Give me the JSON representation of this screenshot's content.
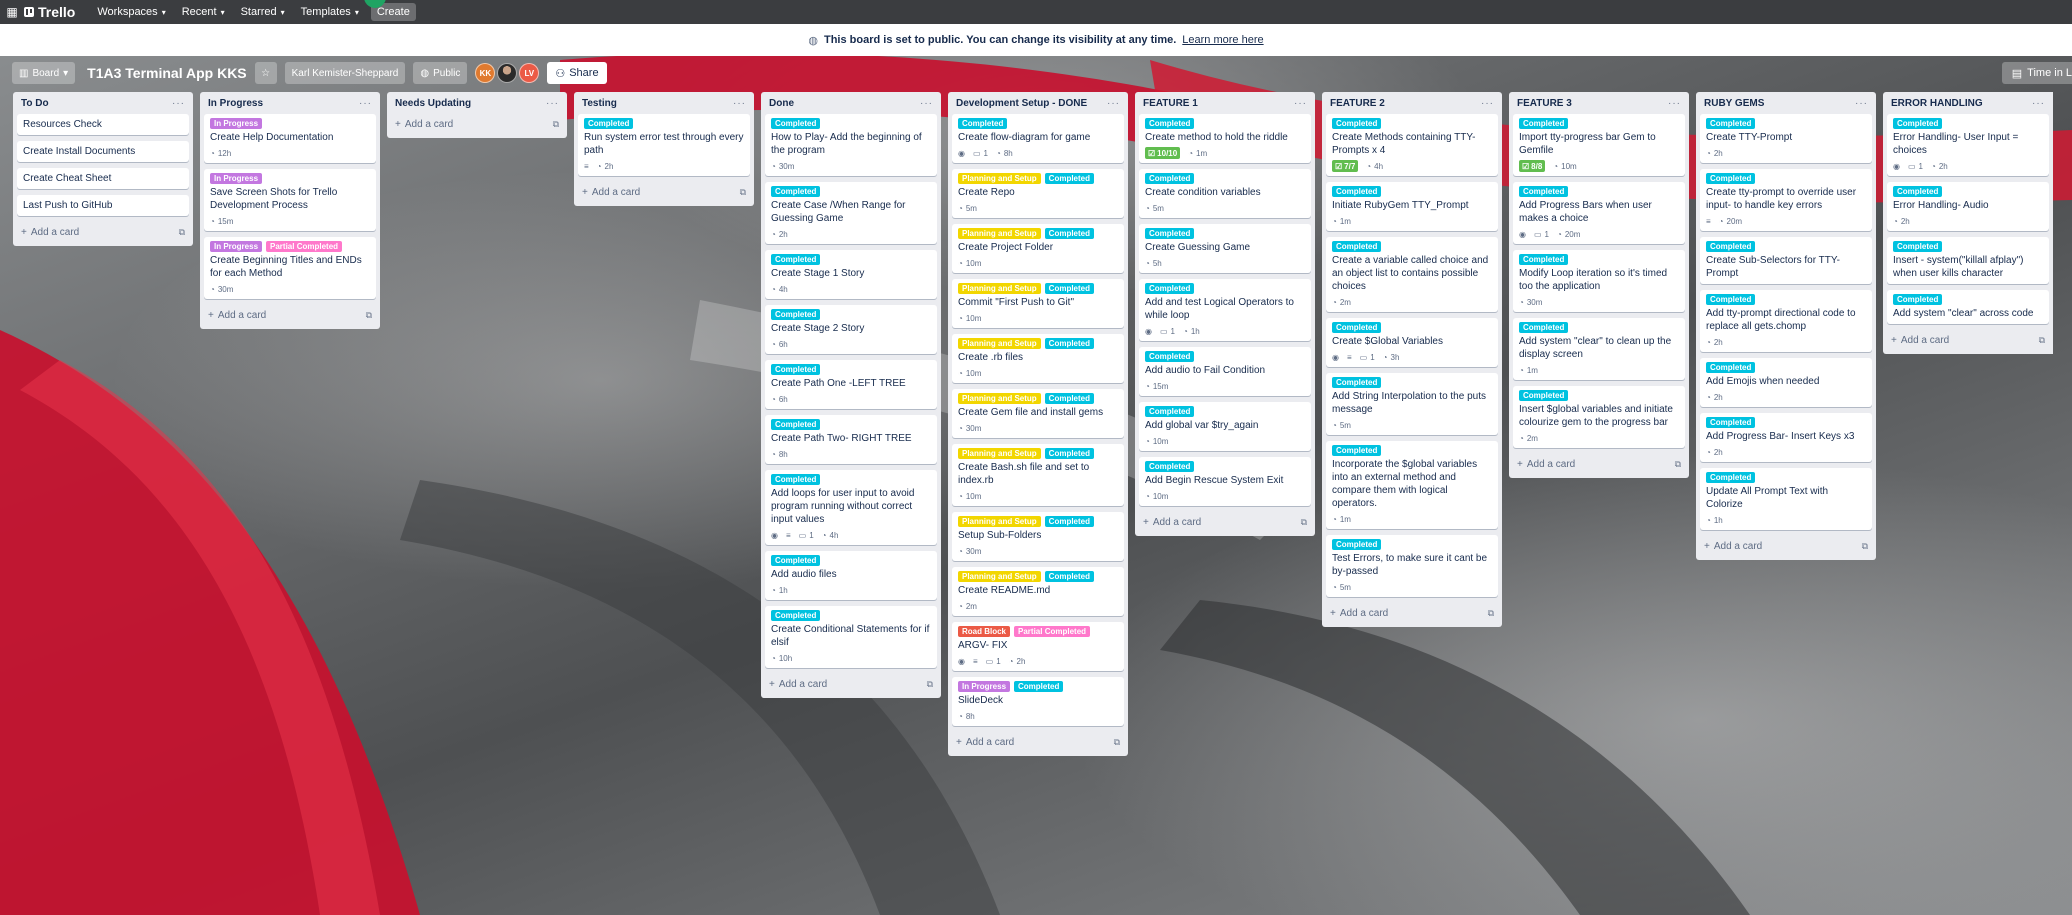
{
  "colors": {
    "Completed": "#00c2e0",
    "In Progress": "#c377e0",
    "Partial Completed": "#ff78cb",
    "Planning and Setup": "#f2d600",
    "Road Block": "#eb5a46"
  },
  "topnav": {
    "brand": "Trello",
    "menus": [
      "Workspaces",
      "Recent",
      "Starred",
      "Templates"
    ],
    "create": "Create"
  },
  "notice": {
    "message": "This board is set to public. You can change its visibility at any time.",
    "link": "Learn more here"
  },
  "board": {
    "view": "Board",
    "title": "T1A3 Terminal App KKS",
    "workspace": "Karl Kemister-Sheppard",
    "visibility": "Public",
    "avatars": [
      "KK",
      "",
      "LV"
    ],
    "avatar_colors": [
      "#e07a2f",
      "",
      "#eb5a46"
    ],
    "share": "Share",
    "time_in": "Time in L"
  },
  "add_card_label": "Add a card",
  "lists": [
    {
      "title": "To Do",
      "cards": [
        {
          "title": "Resources Check"
        },
        {
          "title": "Create Install Documents"
        },
        {
          "title": "Create Cheat Sheet"
        },
        {
          "title": "Last Push to GitHub"
        }
      ]
    },
    {
      "title": "In Progress",
      "cards": [
        {
          "labels": [
            "In Progress"
          ],
          "title": "Create Help Documentation",
          "badges": [
            {
              "icon": "clock",
              "text": "12h"
            }
          ]
        },
        {
          "labels": [
            "In Progress"
          ],
          "title": "Save Screen Shots for Trello Development Process",
          "badges": [
            {
              "icon": "clock",
              "text": "15m"
            }
          ]
        },
        {
          "labels": [
            "In Progress",
            "Partial Completed"
          ],
          "title": "Create Beginning Titles and ENDs for each Method",
          "badges": [
            {
              "icon": "clock",
              "text": "30m"
            }
          ]
        }
      ]
    },
    {
      "title": "Needs Updating",
      "cards": []
    },
    {
      "title": "Testing",
      "cards": [
        {
          "labels": [
            "Completed"
          ],
          "title": "Run system error test through every path",
          "badges": [
            {
              "icon": "desc",
              "text": ""
            },
            {
              "icon": "clock",
              "text": "2h"
            }
          ]
        }
      ]
    },
    {
      "title": "Done",
      "cards": [
        {
          "labels": [
            "Completed"
          ],
          "title": "How to Play- Add the beginning of the program",
          "badges": [
            {
              "icon": "clock",
              "text": "30m"
            }
          ]
        },
        {
          "labels": [
            "Completed"
          ],
          "title": "Create Case /When Range for Guessing Game",
          "badges": [
            {
              "icon": "clock",
              "text": "2h"
            }
          ]
        },
        {
          "labels": [
            "Completed"
          ],
          "title": "Create Stage 1 Story",
          "badges": [
            {
              "icon": "clock",
              "text": "4h"
            }
          ]
        },
        {
          "labels": [
            "Completed"
          ],
          "title": "Create Stage 2 Story",
          "badges": [
            {
              "icon": "clock",
              "text": "6h"
            }
          ]
        },
        {
          "labels": [
            "Completed"
          ],
          "title": "Create Path One -LEFT TREE",
          "badges": [
            {
              "icon": "clock",
              "text": "6h"
            }
          ]
        },
        {
          "labels": [
            "Completed"
          ],
          "title": "Create Path Two- RIGHT TREE",
          "badges": [
            {
              "icon": "clock",
              "text": "8h"
            }
          ]
        },
        {
          "labels": [
            "Completed"
          ],
          "title": "Add loops for user input to avoid program running without correct input values",
          "badges": [
            {
              "icon": "eye",
              "text": ""
            },
            {
              "icon": "desc",
              "text": ""
            },
            {
              "icon": "comment",
              "text": "1"
            },
            {
              "icon": "clock",
              "text": "4h"
            }
          ]
        },
        {
          "labels": [
            "Completed"
          ],
          "title": "Add audio files",
          "badges": [
            {
              "icon": "clock",
              "text": "1h"
            }
          ]
        },
        {
          "labels": [
            "Completed"
          ],
          "title": "Create Conditional Statements for if elsif",
          "badges": [
            {
              "icon": "clock",
              "text": "10h"
            }
          ]
        }
      ]
    },
    {
      "title": "Development Setup - DONE",
      "cards": [
        {
          "labels": [
            "Completed"
          ],
          "title": "Create flow-diagram for game",
          "badges": [
            {
              "icon": "eye",
              "text": ""
            },
            {
              "icon": "comment",
              "text": "1"
            },
            {
              "icon": "clock",
              "text": "8h"
            }
          ]
        },
        {
          "labels": [
            "Planning and Setup",
            "Completed"
          ],
          "title": "Create Repo",
          "badges": [
            {
              "icon": "clock",
              "text": "5m"
            }
          ]
        },
        {
          "labels": [
            "Planning and Setup",
            "Completed"
          ],
          "title": "Create Project Folder",
          "badges": [
            {
              "icon": "clock",
              "text": "10m"
            }
          ]
        },
        {
          "labels": [
            "Planning and Setup",
            "Completed"
          ],
          "title": "Commit \"First Push to Git\"",
          "badges": [
            {
              "icon": "clock",
              "text": "10m"
            }
          ]
        },
        {
          "labels": [
            "Planning and Setup",
            "Completed"
          ],
          "title": "Create .rb files",
          "badges": [
            {
              "icon": "clock",
              "text": "10m"
            }
          ]
        },
        {
          "labels": [
            "Planning and Setup",
            "Completed"
          ],
          "title": "Create Gem file and install gems",
          "badges": [
            {
              "icon": "clock",
              "text": "30m"
            }
          ]
        },
        {
          "labels": [
            "Planning and Setup",
            "Completed"
          ],
          "title": "Create Bash.sh file and set to index.rb",
          "badges": [
            {
              "icon": "clock",
              "text": "10m"
            }
          ]
        },
        {
          "labels": [
            "Planning and Setup",
            "Completed"
          ],
          "title": "Setup Sub-Folders",
          "badges": [
            {
              "icon": "clock",
              "text": "30m"
            }
          ]
        },
        {
          "labels": [
            "Planning and Setup",
            "Completed"
          ],
          "title": "Create README.md",
          "badges": [
            {
              "icon": "clock",
              "text": "2m"
            }
          ]
        },
        {
          "labels": [
            "Road Block",
            "Partial Completed"
          ],
          "title": "ARGV- FIX",
          "badges": [
            {
              "icon": "eye",
              "text": ""
            },
            {
              "icon": "desc",
              "text": ""
            },
            {
              "icon": "comment",
              "text": "1"
            },
            {
              "icon": "clock",
              "text": "2h"
            }
          ]
        },
        {
          "labels": [
            "In Progress",
            "Completed"
          ],
          "title": "SlideDeck",
          "badges": [
            {
              "icon": "clock",
              "text": "8h"
            }
          ]
        }
      ]
    },
    {
      "title": "FEATURE 1",
      "cards": [
        {
          "labels": [
            "Completed"
          ],
          "title": "Create method to hold the riddle",
          "badges": [
            {
              "icon": "check",
              "text": "10/10"
            },
            {
              "icon": "clock",
              "text": "1m"
            }
          ]
        },
        {
          "labels": [
            "Completed"
          ],
          "title": "Create condition variables",
          "badges": [
            {
              "icon": "clock",
              "text": "5m"
            }
          ]
        },
        {
          "labels": [
            "Completed"
          ],
          "title": "Create Guessing Game",
          "badges": [
            {
              "icon": "clock",
              "text": "5h"
            }
          ]
        },
        {
          "labels": [
            "Completed"
          ],
          "title": "Add and test Logical Operators to while loop",
          "badges": [
            {
              "icon": "eye",
              "text": ""
            },
            {
              "icon": "comment",
              "text": "1"
            },
            {
              "icon": "clock",
              "text": "1h"
            }
          ]
        },
        {
          "labels": [
            "Completed"
          ],
          "title": "Add audio to Fail Condition",
          "badges": [
            {
              "icon": "clock",
              "text": "15m"
            }
          ]
        },
        {
          "labels": [
            "Completed"
          ],
          "title": "Add global var $try_again",
          "badges": [
            {
              "icon": "clock",
              "text": "10m"
            }
          ]
        },
        {
          "labels": [
            "Completed"
          ],
          "title": "Add Begin Rescue System Exit",
          "badges": [
            {
              "icon": "clock",
              "text": "10m"
            }
          ]
        }
      ]
    },
    {
      "title": "FEATURE 2",
      "cards": [
        {
          "labels": [
            "Completed"
          ],
          "title": "Create Methods containing TTY-Prompts x 4",
          "badges": [
            {
              "icon": "check",
              "text": "7/7"
            },
            {
              "icon": "clock",
              "text": "4h"
            }
          ]
        },
        {
          "labels": [
            "Completed"
          ],
          "title": "Initiate RubyGem TTY_Prompt",
          "badges": [
            {
              "icon": "clock",
              "text": "1m"
            }
          ]
        },
        {
          "labels": [
            "Completed"
          ],
          "title": "Create a variable called choice and an object list to contains possible choices",
          "badges": [
            {
              "icon": "clock",
              "text": "2m"
            }
          ]
        },
        {
          "labels": [
            "Completed"
          ],
          "title": "Create $Global Variables",
          "badges": [
            {
              "icon": "eye",
              "text": ""
            },
            {
              "icon": "desc",
              "text": ""
            },
            {
              "icon": "comment",
              "text": "1"
            },
            {
              "icon": "clock",
              "text": "3h"
            }
          ]
        },
        {
          "labels": [
            "Completed"
          ],
          "title": "Add String Interpolation to the puts message",
          "badges": [
            {
              "icon": "clock",
              "text": "5m"
            }
          ]
        },
        {
          "labels": [
            "Completed"
          ],
          "title": "Incorporate the $global variables into an external method and compare them with logical operators.",
          "badges": [
            {
              "icon": "clock",
              "text": "1m"
            }
          ]
        },
        {
          "labels": [
            "Completed"
          ],
          "title": "Test Errors, to make sure it cant be by-passed",
          "badges": [
            {
              "icon": "clock",
              "text": "5m"
            }
          ]
        }
      ]
    },
    {
      "title": "FEATURE 3",
      "cards": [
        {
          "labels": [
            "Completed"
          ],
          "title": "Import tty-progress bar Gem to Gemfile",
          "badges": [
            {
              "icon": "check",
              "text": "8/8"
            },
            {
              "icon": "clock",
              "text": "10m"
            }
          ]
        },
        {
          "labels": [
            "Completed"
          ],
          "title": "Add Progress Bars when user makes a choice",
          "badges": [
            {
              "icon": "eye",
              "text": ""
            },
            {
              "icon": "comment",
              "text": "1"
            },
            {
              "icon": "clock",
              "text": "20m"
            }
          ]
        },
        {
          "labels": [
            "Completed"
          ],
          "title": "Modify Loop iteration so it's timed too the application",
          "badges": [
            {
              "icon": "clock",
              "text": "30m"
            }
          ]
        },
        {
          "labels": [
            "Completed"
          ],
          "title": "Add system \"clear\" to clean up the display screen",
          "badges": [
            {
              "icon": "clock",
              "text": "1m"
            }
          ]
        },
        {
          "labels": [
            "Completed"
          ],
          "title": "Insert $global variables and initiate colourize gem to the progress bar",
          "badges": [
            {
              "icon": "clock",
              "text": "2m"
            }
          ]
        }
      ]
    },
    {
      "title": "RUBY GEMS",
      "cards": [
        {
          "labels": [
            "Completed"
          ],
          "title": "Create TTY-Prompt",
          "badges": [
            {
              "icon": "clock",
              "text": "2h"
            }
          ]
        },
        {
          "labels": [
            "Completed"
          ],
          "title": "Create tty-prompt to override user input- to handle key errors",
          "badges": [
            {
              "icon": "desc",
              "text": ""
            },
            {
              "icon": "clock",
              "text": "20m"
            }
          ]
        },
        {
          "labels": [
            "Completed"
          ],
          "title": "Create Sub-Selectors for TTY-Prompt",
          "badges": []
        },
        {
          "labels": [
            "Completed"
          ],
          "title": "Add tty-prompt directional code to replace all gets.chomp",
          "badges": [
            {
              "icon": "clock",
              "text": "2h"
            }
          ]
        },
        {
          "labels": [
            "Completed"
          ],
          "title": "Add Emojis when needed",
          "badges": [
            {
              "icon": "clock",
              "text": "2h"
            }
          ]
        },
        {
          "labels": [
            "Completed"
          ],
          "title": "Add Progress Bar- Insert Keys x3",
          "badges": [
            {
              "icon": "clock",
              "text": "2h"
            }
          ]
        },
        {
          "labels": [
            "Completed"
          ],
          "title": "Update All Prompt Text with Colorize",
          "badges": [
            {
              "icon": "clock",
              "text": "1h"
            }
          ]
        }
      ]
    },
    {
      "title": "ERROR HANDLING",
      "cards": [
        {
          "labels": [
            "Completed"
          ],
          "title": "Error Handling- User Input = choices",
          "badges": [
            {
              "icon": "eye",
              "text": ""
            },
            {
              "icon": "comment",
              "text": "1"
            },
            {
              "icon": "clock",
              "text": "2h"
            }
          ]
        },
        {
          "labels": [
            "Completed"
          ],
          "title": "Error Handling- Audio",
          "badges": [
            {
              "icon": "clock",
              "text": "2h"
            }
          ]
        },
        {
          "labels": [
            "Completed"
          ],
          "title": "Insert - system(\"killall afplay\") when user kills character",
          "badges": []
        },
        {
          "labels": [
            "Completed"
          ],
          "title": "Add system \"clear\" across code",
          "badges": []
        }
      ]
    }
  ]
}
